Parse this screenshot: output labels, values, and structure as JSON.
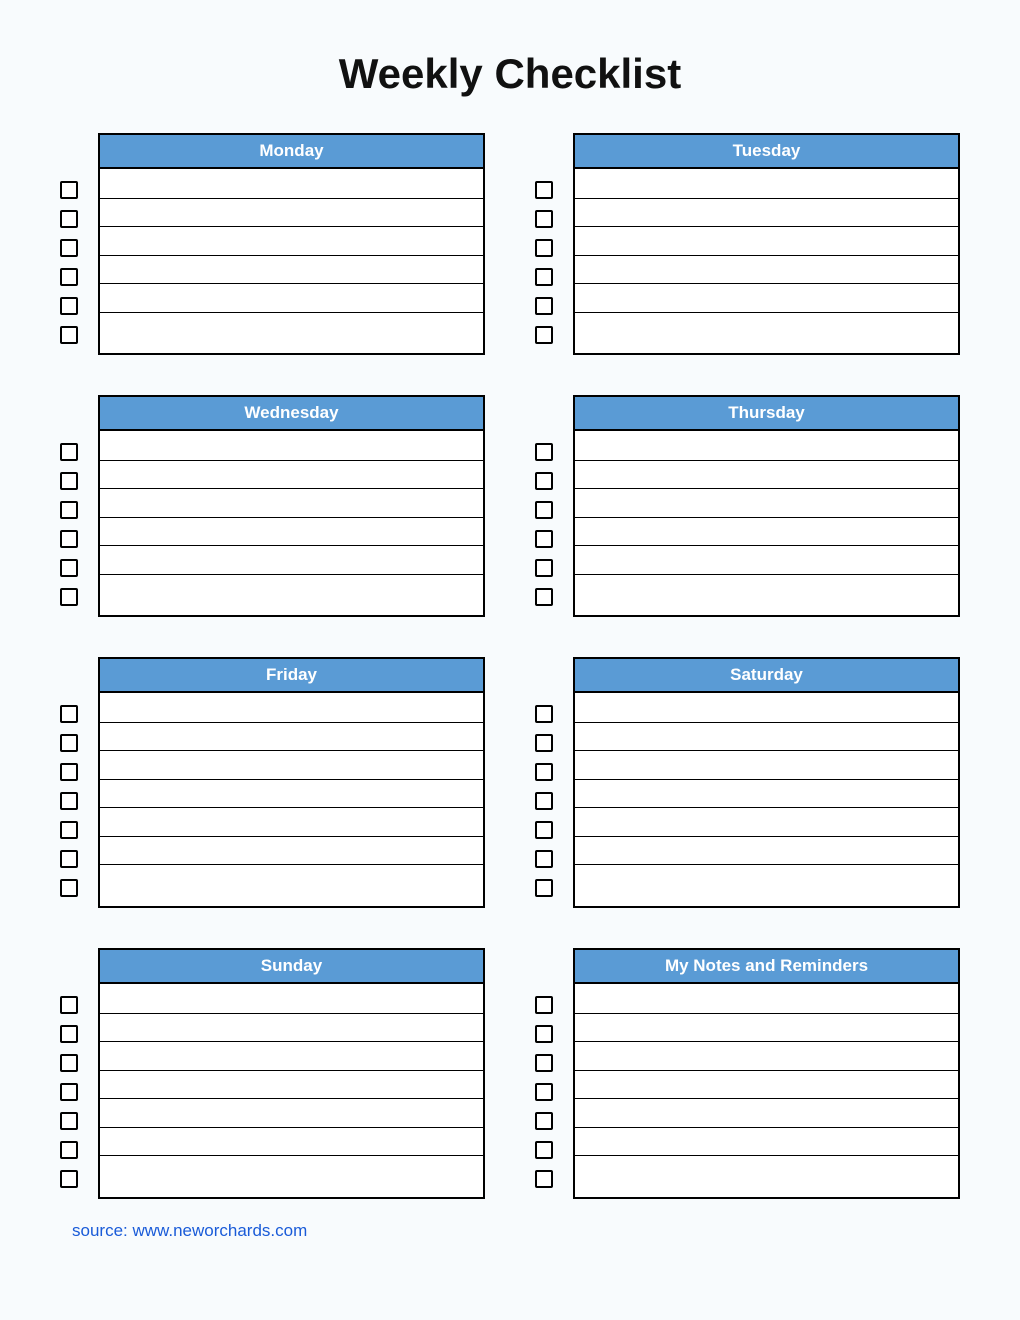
{
  "title": "Weekly Checklist",
  "source_label": "source: www.neworchards.com",
  "header_color": "#5A9BD5",
  "blocks": [
    {
      "label": "Monday",
      "rows": 6
    },
    {
      "label": "Tuesday",
      "rows": 6
    },
    {
      "label": "Wednesday",
      "rows": 6
    },
    {
      "label": "Thursday",
      "rows": 6
    },
    {
      "label": "Friday",
      "rows": 7
    },
    {
      "label": "Saturday",
      "rows": 7
    },
    {
      "label": "Sunday",
      "rows": 7
    },
    {
      "label": "My Notes and Reminders",
      "rows": 7
    }
  ]
}
